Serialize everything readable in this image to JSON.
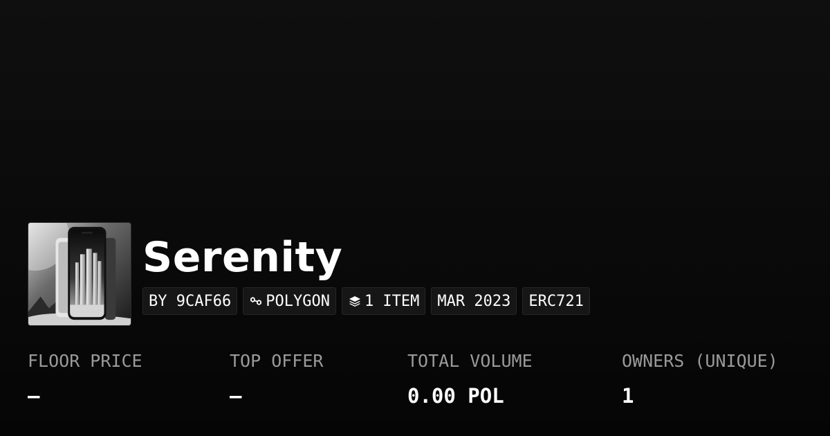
{
  "collection": {
    "thumbnail_icon": "smartphone-cityscape-image",
    "title": "Serenity"
  },
  "tags": {
    "creator": "BY 9CAF66",
    "chain": "POLYGON",
    "chain_icon": "polygon-icon",
    "items": "1 ITEM",
    "items_icon": "layers-icon",
    "date": "MAR 2023",
    "standard": "ERC721"
  },
  "stats": {
    "floor_price": {
      "label": "FLOOR PRICE",
      "value": "–"
    },
    "top_offer": {
      "label": "TOP OFFER",
      "value": "–"
    },
    "total_volume": {
      "label": "TOTAL VOLUME",
      "value": "0.00 POL"
    },
    "owners": {
      "label": "OWNERS (UNIQUE)",
      "value": "1"
    }
  },
  "colors": {
    "background": "#0a0a0a",
    "text": "#ffffff",
    "muted": "#9a9a9a",
    "tag_bg": "#161616"
  }
}
